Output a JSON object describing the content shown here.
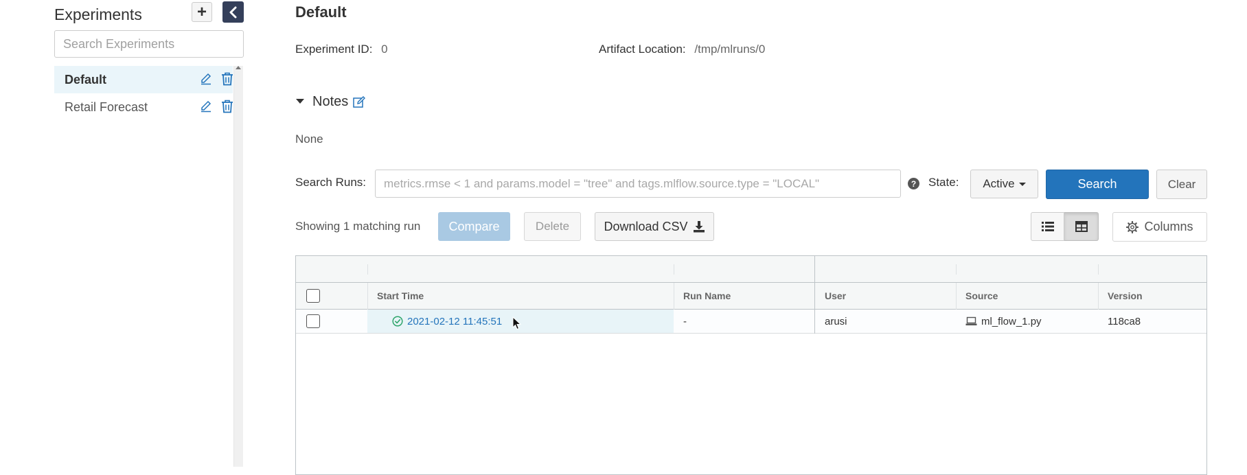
{
  "sidebar": {
    "title": "Experiments",
    "add_icon": "plus-icon",
    "collapse_icon": "chevron-left-icon",
    "search_placeholder": "Search Experiments",
    "items": [
      {
        "label": "Default",
        "active": true
      },
      {
        "label": "Retail Forecast",
        "active": false
      }
    ]
  },
  "experiment": {
    "name": "Default",
    "id_label": "Experiment ID",
    "id_value": "0",
    "artifact_label": "Artifact Location",
    "artifact_value": "/tmp/mlruns/0"
  },
  "notes": {
    "title": "Notes",
    "body": "None"
  },
  "search": {
    "label": "Search Runs:",
    "placeholder": "metrics.rmse < 1 and params.model = \"tree\" and tags.mlflow.source.type = \"LOCAL\"",
    "help": "?",
    "state_label": "State:",
    "state_value": "Active",
    "search_button": "Search",
    "clear_button": "Clear"
  },
  "actions": {
    "count_text": "Showing 1 matching run",
    "compare": "Compare",
    "delete": "Delete",
    "download_csv": "Download CSV",
    "columns": "Columns"
  },
  "table": {
    "columns": [
      "Start Time",
      "Run Name",
      "User",
      "Source",
      "Version"
    ],
    "rows": [
      {
        "start_time": "2021-02-12 11:45:51",
        "run_name": "-",
        "user": "arusi",
        "source": "ml_flow_1.py",
        "version": "118ca8",
        "status": "finished"
      }
    ]
  },
  "colors": {
    "primary": "#2374bb",
    "sidebar_active": "#eaf5fa",
    "collapse_button": "#343f5a",
    "success": "#2ea56b"
  }
}
